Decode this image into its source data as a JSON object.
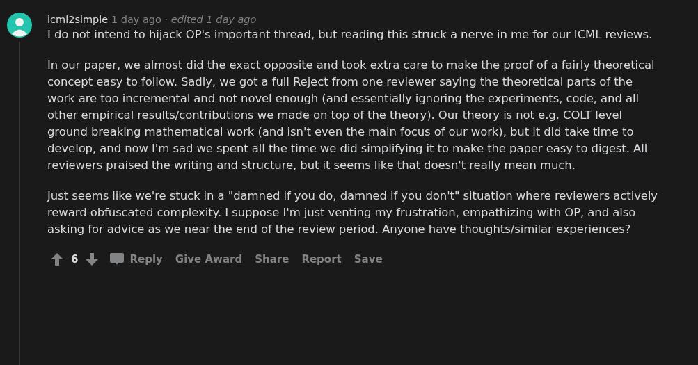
{
  "comment": {
    "author": "icml2simple",
    "time": "1 day ago",
    "separator": "·",
    "edited": "edited 1 day ago",
    "paragraphs": [
      "I do not intend to hijack OP's important thread, but reading this struck a nerve in me for our ICML reviews.",
      "In our paper, we almost did the exact opposite and took extra care to make the proof of a fairly theoretical concept easy to follow. Sadly, we got a full Reject from one reviewer saying the theoretical parts of the work are too incremental and not novel enough (and essentially ignoring the experiments, code, and all other empirical results/contributions we made on top of the theory). Our theory is not e.g. COLT level ground breaking mathematical work (and isn't even the main focus of our work), but it did take time to develop, and now I'm sad we spent all the time we did simplifying it to make the paper easy to digest. All reviewers praised the writing and structure, but it seems like that doesn't really mean much.",
      "Just seems like we're stuck in a \"damned if you do, damned if you don't\" situation where reviewers actively reward obfuscated complexity. I suppose I'm just venting my frustration, empathizing with OP, and also asking for advice as we near the end of the review period. Anyone have thoughts/similar experiences?"
    ],
    "score": "6",
    "actions": [
      "Reply",
      "Give Award",
      "Share",
      "Report",
      "Save"
    ]
  }
}
